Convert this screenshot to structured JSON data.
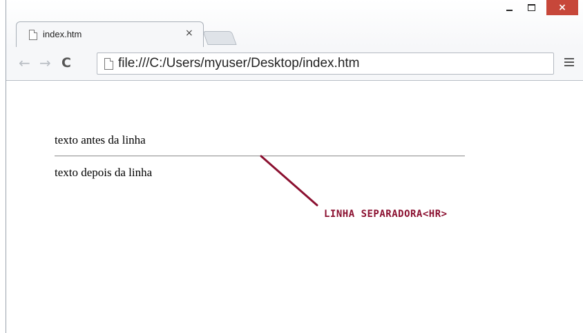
{
  "window": {
    "controls": {
      "minimize": "",
      "maximize": "",
      "close": "×"
    }
  },
  "tabs": [
    {
      "title": "index.htm",
      "close": "×"
    }
  ],
  "toolbar": {
    "back": "←",
    "forward": "→",
    "reload": "C",
    "url": "file:///C:/Users/myuser/Desktop/index.htm"
  },
  "page": {
    "text_before": "texto antes da linha",
    "text_after": "texto depois da linha"
  },
  "annotation": {
    "label": "LINHA SEPARADORA<HR>",
    "color": "#8b1030"
  },
  "colors": {
    "close_button": "#c7473a",
    "toolbar_bg": "#f6f7f9"
  }
}
